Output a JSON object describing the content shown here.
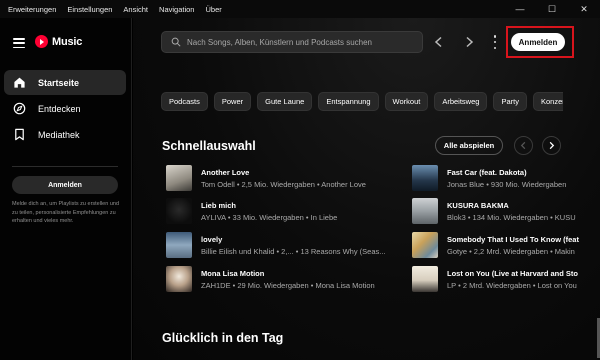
{
  "titlebar": {
    "menu": [
      "Erweiterungen",
      "Einstellungen",
      "Ansicht",
      "Navigation",
      "Über"
    ],
    "controls": [
      "—",
      "☐",
      "✕"
    ]
  },
  "sidebar": {
    "logo": "Music",
    "nav": [
      {
        "label": "Startseite",
        "icon": "home-icon",
        "active": true
      },
      {
        "label": "Entdecken",
        "icon": "compass-icon",
        "active": false
      },
      {
        "label": "Mediathek",
        "icon": "library-icon",
        "active": false
      }
    ],
    "login_label": "Anmelden",
    "info": "Melde dich an, um Playlists zu erstellen und zu teilen, personalisierte Empfehlungen zu erhalten und vieles mehr."
  },
  "header": {
    "search_placeholder": "Nach Songs, Alben, Künstlern und Podcasts suchen",
    "login_label": "Anmelden",
    "highlight_color": "#d8141c"
  },
  "chips": [
    "Podcasts",
    "Power",
    "Gute Laune",
    "Entspannung",
    "Workout",
    "Arbeitsweg",
    "Party",
    "Konzentration"
  ],
  "quick_picks": {
    "title": "Schnellauswahl",
    "play_all_label": "Alle abspielen",
    "tracks": [
      {
        "title": "Another Love",
        "subtitle": "Tom Odell • 2,5 Mio. Wiedergaben • Another Love"
      },
      {
        "title": "Lieb mich",
        "subtitle": "AYLIVA • 33 Mio. Wiedergaben • In Liebe"
      },
      {
        "title": "lovely",
        "subtitle": "Billie Eilish und Khalid • 2,... • 13 Reasons Why (Seas..."
      },
      {
        "title": "Mona Lisa Motion",
        "subtitle": "ZAH1DE • 29 Mio. Wiedergaben • Mona Lisa Motion"
      },
      {
        "title": "Fast Car (feat. Dakota)",
        "subtitle": "Jonas Blue • 930 Mio. Wiedergaben"
      },
      {
        "title": "KUSURA BAKMA",
        "subtitle": "Blok3 • 134 Mio. Wiedergaben • KUSU"
      },
      {
        "title": "Somebody That I Used To Know (feat",
        "subtitle": "Gotye • 2,2 Mrd. Wiedergaben • Makin"
      },
      {
        "title": "Lost on You (Live at Harvard and Sto",
        "subtitle": "LP • 2 Mrd. Wiedergaben • Lost on You"
      }
    ]
  },
  "next_section": {
    "title": "Glücklich in den Tag"
  }
}
